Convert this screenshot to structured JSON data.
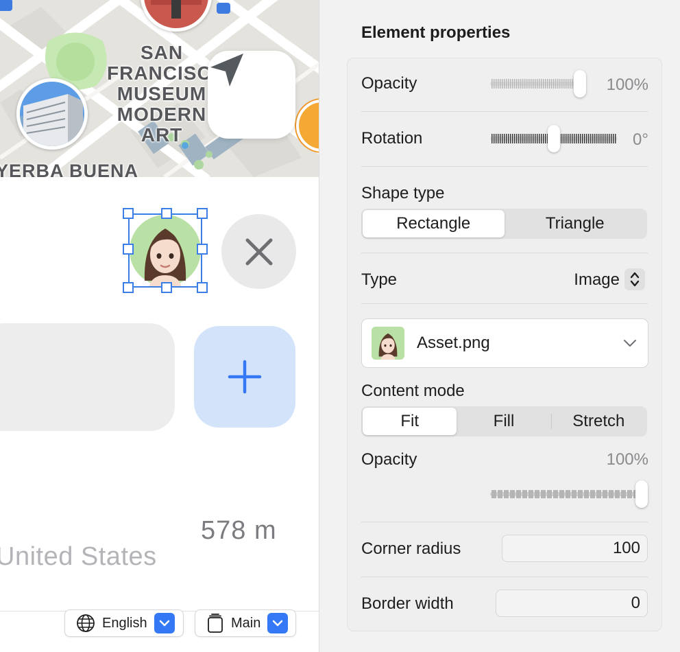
{
  "map": {
    "museum_label": "SAN\nFRANCISCO\nMUSEUM\nMODERN ART",
    "yerba_label": "YERBA BUENA"
  },
  "icons": {
    "location": "location-arrow-icon",
    "close": "close-icon",
    "plus": "plus-icon",
    "globe": "globe-icon",
    "device": "device-icon",
    "chevron": "chevron-down-icon",
    "stepper": "up-down-chevron-icon"
  },
  "canvas": {
    "distance": "578 m",
    "country": "United States"
  },
  "bottom_bar": {
    "language": "English",
    "scheme": "Main"
  },
  "panel": {
    "title": "Element properties",
    "opacity": {
      "label": "Opacity",
      "value": "100%",
      "level": 1.0
    },
    "rotation": {
      "label": "Rotation",
      "value": "0°",
      "level": 0.5
    },
    "shape_type": {
      "label": "Shape type",
      "options": [
        "Rectangle",
        "Triangle"
      ],
      "selected": "Rectangle"
    },
    "type": {
      "label": "Type",
      "value": "Image"
    },
    "asset": {
      "name": "Asset.png"
    },
    "content_mode": {
      "label": "Content mode",
      "options": [
        "Fit",
        "Fill",
        "Stretch"
      ],
      "selected": "Fit"
    },
    "image_opacity": {
      "label": "Opacity",
      "value": "100%",
      "level": 1.0
    },
    "corner_radius": {
      "label": "Corner radius",
      "value": "100"
    },
    "border_width": {
      "label": "Border width",
      "value": "0"
    }
  },
  "colors": {
    "accent": "#3478f6",
    "selection": "#3c7ee8",
    "avatar_bg": "#b9e0a5",
    "plus_bg": "#d3e4fa",
    "panel_bg": "#f2f2f2"
  }
}
